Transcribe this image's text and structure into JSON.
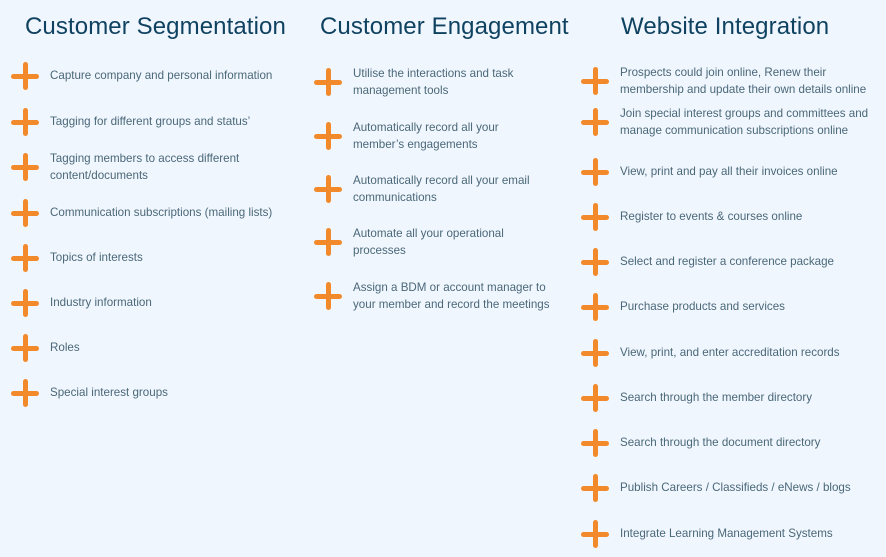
{
  "accent_color": "#f28a2b",
  "title_color": "#0f4260",
  "text_color": "#4a6878",
  "columns": [
    {
      "title": "Customer Segmentation",
      "items": [
        {
          "icon": "plus-icon",
          "lines": [
            "Capture company and personal information"
          ]
        },
        {
          "icon": "plus-icon",
          "lines": [
            "Tagging for different groups and status’"
          ]
        },
        {
          "icon": "plus-icon",
          "lines": [
            "Tagging members to access different",
            "content/documents"
          ]
        },
        {
          "icon": "plus-icon",
          "lines": [
            "Communication subscriptions (mailing lists)"
          ]
        },
        {
          "icon": "plus-icon",
          "lines": [
            "Topics of interests"
          ]
        },
        {
          "icon": "plus-icon",
          "lines": [
            "Industry information"
          ]
        },
        {
          "icon": "plus-icon",
          "lines": [
            "Roles"
          ]
        },
        {
          "icon": "plus-icon",
          "lines": [
            "Special interest groups"
          ]
        }
      ]
    },
    {
      "title": "Customer Engagement",
      "items": [
        {
          "icon": "plus-icon",
          "lines": [
            "Utilise the interactions and task",
            "management tools"
          ]
        },
        {
          "icon": "plus-icon",
          "lines": [
            "Automatically record all your",
            "member’s engagements"
          ]
        },
        {
          "icon": "plus-icon",
          "lines": [
            "Automatically record all your email",
            "communications"
          ]
        },
        {
          "icon": "plus-icon",
          "lines": [
            "Automate all your operational",
            "processes"
          ]
        },
        {
          "icon": "plus-icon",
          "lines": [
            "Assign a BDM or account manager to",
            "your member and record the meetings"
          ]
        }
      ]
    },
    {
      "title": "Website Integration",
      "items": [
        {
          "icon": "plus-icon",
          "lines": [
            "Prospects could join online, Renew their",
            "membership and update their own details online"
          ]
        },
        {
          "icon": "plus-icon",
          "lines": [
            "Join special interest groups and committees and",
            "manage communication subscriptions online"
          ]
        },
        {
          "icon": "plus-icon",
          "lines": [
            "View, print and pay all their invoices online"
          ]
        },
        {
          "icon": "plus-icon",
          "lines": [
            "Register to events & courses online"
          ]
        },
        {
          "icon": "plus-icon",
          "lines": [
            "Select and register a conference package"
          ]
        },
        {
          "icon": "plus-icon",
          "lines": [
            "Purchase products and services"
          ]
        },
        {
          "icon": "plus-icon",
          "lines": [
            "View, print, and enter accreditation records"
          ]
        },
        {
          "icon": "plus-icon",
          "lines": [
            "Search through the member directory"
          ]
        },
        {
          "icon": "plus-icon",
          "lines": [
            "Search through the document directory"
          ]
        },
        {
          "icon": "plus-icon",
          "lines": [
            "Publish Careers / Classifieds / eNews / blogs"
          ]
        },
        {
          "icon": "plus-icon",
          "lines": [
            "Integrate Learning Management Systems"
          ]
        }
      ]
    }
  ]
}
